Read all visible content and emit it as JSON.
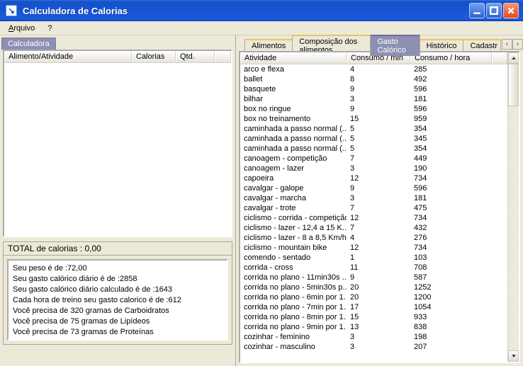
{
  "window": {
    "title": "Calculadora de Calorias"
  },
  "menu": {
    "arquivo": "Arquivo",
    "help": "?"
  },
  "left": {
    "tab": "Calculadora",
    "cols": {
      "alimento": "Alimento/Atividade",
      "calorias": "Calorias",
      "qtd": "Qtd."
    },
    "total_header": "TOTAL de calorias : 0,00",
    "info": [
      "Seu peso é de :72,00",
      "Seu gasto calórico diário é de :2858",
      "Seu gasto calórico diário calculado é de :1643",
      "Cada hora de treino seu gasto calorico é de :612",
      "Você precisa de 320 gramas de Carboidratos",
      "Você precisa de  75 gramas de Lipídeos",
      "Você precisa de  73 gramas de Proteínas"
    ]
  },
  "right": {
    "tabs": {
      "alimentos": "Alimentos",
      "composicao": "Composição dos alimentos",
      "gasto": "Gasto Calórico",
      "historico": "Histórico",
      "cadastro": "Cadastr"
    },
    "spin_left": "‹",
    "spin_right": "›",
    "cols": {
      "atividade": "Atividade",
      "min": "Consumo / min",
      "hora": "Consumo / hora"
    },
    "rows": [
      {
        "a": "arco e flexa",
        "m": "4",
        "h": "285"
      },
      {
        "a": "ballet",
        "m": "8",
        "h": "492"
      },
      {
        "a": "basquete",
        "m": "9",
        "h": "596"
      },
      {
        "a": "bilhar",
        "m": "3",
        "h": "181"
      },
      {
        "a": "box no ringue",
        "m": "9",
        "h": "596"
      },
      {
        "a": "box no treinamento",
        "m": "15",
        "h": "959"
      },
      {
        "a": "caminhada a passo normal (...",
        "m": "5",
        "h": "354"
      },
      {
        "a": "caminhada a passo normal (...",
        "m": "5",
        "h": "345"
      },
      {
        "a": "caminhada a passo normal (...",
        "m": "5",
        "h": "354"
      },
      {
        "a": "canoagem - competição",
        "m": "7",
        "h": "449"
      },
      {
        "a": "canoagem - lazer",
        "m": "3",
        "h": "190"
      },
      {
        "a": "capoeira",
        "m": "12",
        "h": "734"
      },
      {
        "a": "cavalgar - galope",
        "m": "9",
        "h": "596"
      },
      {
        "a": "cavalgar - marcha",
        "m": "3",
        "h": "181"
      },
      {
        "a": "cavalgar - trote",
        "m": "7",
        "h": "475"
      },
      {
        "a": "ciclismo - corrida - competição",
        "m": "12",
        "h": "734"
      },
      {
        "a": "ciclismo - lazer - 12,4 a 15 K...",
        "m": "7",
        "h": "432"
      },
      {
        "a": "ciclismo - lazer - 8 a 8,5 Km/h",
        "m": "4",
        "h": "276"
      },
      {
        "a": "ciclismo - mountain bike",
        "m": "12",
        "h": "734"
      },
      {
        "a": "comendo - sentado",
        "m": "1",
        "h": "103"
      },
      {
        "a": "corrida - cross",
        "m": "11",
        "h": "708"
      },
      {
        "a": "corrida no plano - 11min30s ...",
        "m": "9",
        "h": "587"
      },
      {
        "a": "corrida no plano - 5min30s p...",
        "m": "20",
        "h": "1252"
      },
      {
        "a": "corrida no plano - 6min por 1...",
        "m": "20",
        "h": "1200"
      },
      {
        "a": "corrida no plano - 7min por 1...",
        "m": "17",
        "h": "1054"
      },
      {
        "a": "corrida no plano - 8min por 1...",
        "m": "15",
        "h": "933"
      },
      {
        "a": "corrida no plano - 9min por 1...",
        "m": "13",
        "h": "838"
      },
      {
        "a": "cozinhar - feminino",
        "m": "3",
        "h": "198"
      },
      {
        "a": "cozinhar - masculino",
        "m": "3",
        "h": "207"
      }
    ]
  }
}
